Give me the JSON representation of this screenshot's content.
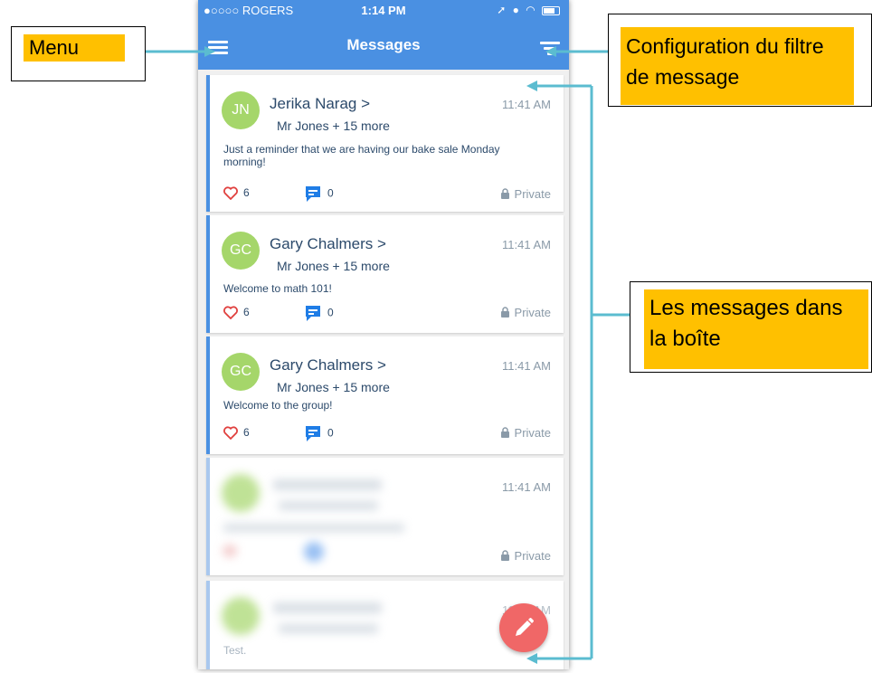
{
  "status_bar": {
    "carrier": "●○○○○ ROGERS",
    "time": "1:14 PM"
  },
  "header": {
    "title": "Messages",
    "menu_icon": "hamburger-menu-icon",
    "filter_icon": "filter-icon"
  },
  "messages": [
    {
      "initials": "JN",
      "sender": "Jerika Narag >",
      "recipients": "Mr Jones + 15 more",
      "time": "11:41 AM",
      "body": "Just a reminder that we are having our bake sale Monday morning!",
      "likes": "6",
      "comments": "0",
      "privacy": "Private"
    },
    {
      "initials": "GC",
      "sender": "Gary Chalmers >",
      "recipients": "Mr Jones + 15 more",
      "time": "11:41 AM",
      "body": "Welcome to math 101!",
      "likes": "6",
      "comments": "0",
      "privacy": "Private"
    },
    {
      "initials": "GC",
      "sender": "Gary Chalmers >",
      "recipients": "Mr Jones + 15 more",
      "time": "11:41 AM",
      "body": "Welcome to the group!",
      "likes": "6",
      "comments": "0",
      "privacy": "Private"
    },
    {
      "time": "11:41 AM",
      "privacy": "Private"
    },
    {
      "time": "11:41 AM",
      "body": "Test."
    }
  ],
  "compose_icon": "pencil-icon",
  "annotations": {
    "menu": "Menu",
    "filter": "Configuration du filtre de message",
    "inbox": "Les messages dans la boîte"
  },
  "colors": {
    "header": "#4a90e2",
    "avatar": "#a5d66a",
    "fab": "#f06767",
    "annotation": "#ffc000",
    "connector": "#5bbcd0"
  }
}
